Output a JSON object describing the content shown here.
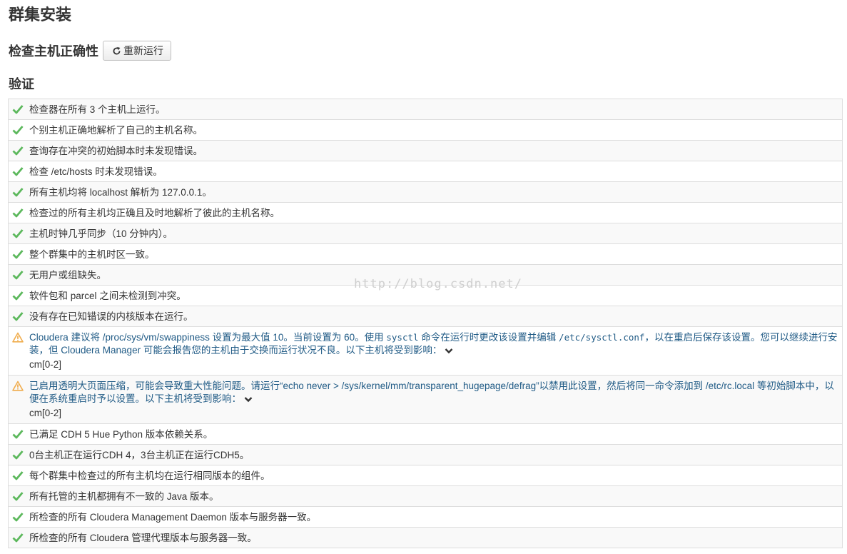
{
  "page": {
    "title": "群集安装",
    "section_title": "检查主机正确性",
    "rerun_label": "重新运行",
    "validation_title": "验证"
  },
  "colors": {
    "ok": "#5cb85c",
    "warn": "#f0ad4e",
    "warn_text": "#1f5a85"
  },
  "checks": [
    {
      "status": "ok",
      "text": "检查器在所有 3 个主机上运行。"
    },
    {
      "status": "ok",
      "text": "个别主机正确地解析了自己的主机名称。"
    },
    {
      "status": "ok",
      "text": "查询存在冲突的初始脚本时未发现错误。"
    },
    {
      "status": "ok",
      "text": "检查 /etc/hosts 时未发现错误。"
    },
    {
      "status": "ok",
      "text": "所有主机均将 localhost 解析为 127.0.0.1。"
    },
    {
      "status": "ok",
      "text": "检查过的所有主机均正确且及时地解析了彼此的主机名称。"
    },
    {
      "status": "ok",
      "text": "主机时钟几乎同步（10 分钟内）。"
    },
    {
      "status": "ok",
      "text": "整个群集中的主机时区一致。"
    },
    {
      "status": "ok",
      "text": "无用户或组缺失。"
    },
    {
      "status": "ok",
      "text": "软件包和 parcel 之间未检测到冲突。"
    },
    {
      "status": "ok",
      "text": "没有存在已知错误的内核版本在运行。"
    },
    {
      "status": "warn",
      "parts": [
        {
          "t": "Cloudera 建议将 /proc/sys/vm/swappiness 设置为最大值 10。当前设置为 60。使用 "
        },
        {
          "t": "sysctl",
          "mono": true
        },
        {
          "t": " 命令在运行时更改该设置并编辑 "
        },
        {
          "t": "/etc/sysctl.conf",
          "mono": true
        },
        {
          "t": "，以在重启后保存该设置。您可以继续进行安装，但 Cloudera Manager 可能会报告您的主机由于交换而运行状况不良。以下主机将受到影响："
        }
      ],
      "hosts": "cm[0-2]"
    },
    {
      "status": "warn",
      "parts": [
        {
          "t": "已启用透明大页面压缩，可能会导致重大性能问题。请运行“echo never > /sys/kernel/mm/transparent_hugepage/defrag”以禁用此设置，然后将同一命令添加到 /etc/rc.local 等初始脚本中，以便在系统重启时予以设置。以下主机将受到影响："
        }
      ],
      "hosts": "cm[0-2]"
    },
    {
      "status": "ok",
      "text": "已满足 CDH 5 Hue Python 版本依赖关系。"
    },
    {
      "status": "ok",
      "text": "0台主机正在运行CDH 4，3台主机正在运行CDH5。"
    },
    {
      "status": "ok",
      "text": "每个群集中检查过的所有主机均在运行相同版本的组件。"
    },
    {
      "status": "ok",
      "text": "所有托管的主机都拥有不一致的 Java 版本。"
    },
    {
      "status": "ok",
      "text": "所检查的所有 Cloudera Management Daemon 版本与服务器一致。"
    },
    {
      "status": "ok",
      "text": "所检查的所有 Cloudera 管理代理版本与服务器一致。"
    }
  ],
  "watermark": "http://blog.csdn.net/"
}
